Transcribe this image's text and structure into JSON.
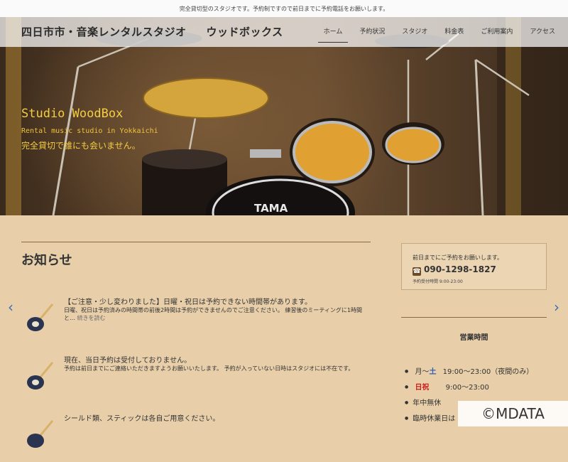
{
  "top_notice": "完全貸切型のスタジオです。予約制ですので前日までに予約電話をお願いします。",
  "header": {
    "logo_main": "四日市市・音楽レンタルスタジオ",
    "logo_sub": "ウッドボックス",
    "nav": [
      "ホーム",
      "予約状況",
      "スタジオ",
      "料金表",
      "ご利用案内",
      "アクセス"
    ],
    "active_nav": "ホーム"
  },
  "hero": {
    "title": "Studio WoodBox",
    "subtitle": "Rental music studio in Yokkaichi",
    "catch": "完全貸切で誰にも会いません。",
    "drum_brand": "TAMA"
  },
  "news": {
    "heading": "お知らせ",
    "items": [
      {
        "title": "【ご注意・少し変わりました】日曜・祝日は予約できない時間帯があります。",
        "excerpt": "日曜、祝日は予約済みの時間帯の前後2時間は予約ができませんのでご注意ください。 練習後のミーティングに1時間と…",
        "more": "続きを読む"
      },
      {
        "title": "現在、当日予約は受付しておりません。",
        "excerpt": "予約は前日までにご連絡いただきますようお願いいたします。 予約が入っていない日時はスタジオには不在です。",
        "more": ""
      },
      {
        "title": "シールド類、スティックは各自ご用意ください。",
        "excerpt": "",
        "more": ""
      }
    ]
  },
  "sidebar": {
    "contact_lead": "前日までにご予約をお願いします。",
    "phone": "090-1298-1827",
    "reception_hours": "予約受付時間 9:00-23:00",
    "business_heading": "営業時間",
    "business_hours": [
      {
        "label_a": "月〜",
        "label_b": "土",
        "time": "19:00〜23:00（夜間のみ）"
      },
      {
        "label": "日祝",
        "time": "9:00〜23:00"
      },
      {
        "text": "年中無休"
      },
      {
        "text": "臨時休業日は"
      }
    ]
  },
  "watermark": "©MDATA",
  "colors": {
    "page_bg": "#e8cfaa",
    "hero_text": "#f4cd43",
    "saturday": "#2f5fb3",
    "holiday": "#c8201d",
    "arrow": "#3a6fb0"
  }
}
